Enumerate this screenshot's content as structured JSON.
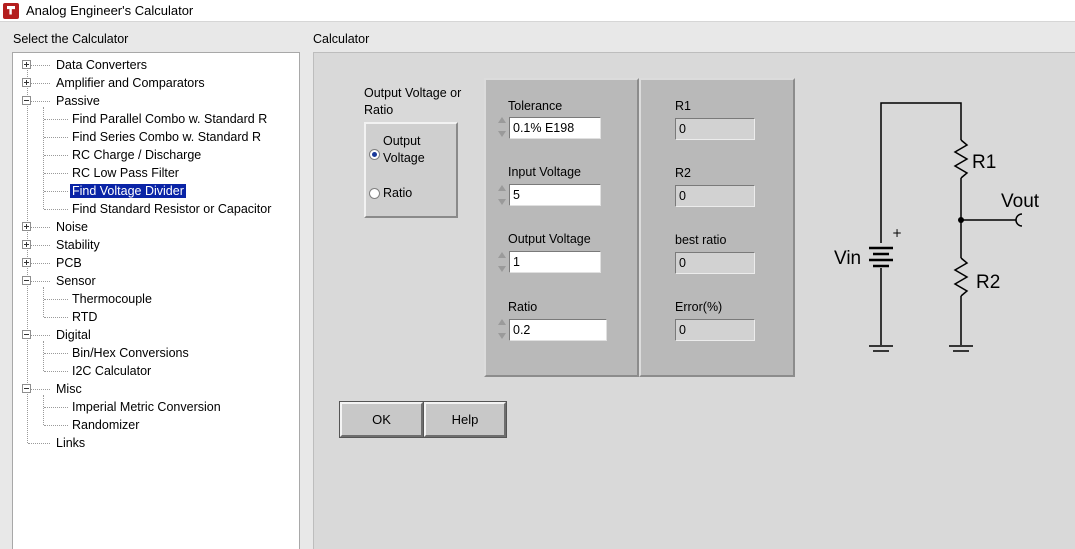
{
  "window": {
    "title": "Analog Engineer's Calculator"
  },
  "left_panel": {
    "label": "Select the Calculator",
    "tree": [
      {
        "label": "Data Converters",
        "level": 0,
        "expander": "plus"
      },
      {
        "label": "Amplifier and Comparators",
        "level": 0,
        "expander": "plus"
      },
      {
        "label": "Passive",
        "level": 0,
        "expander": "minus"
      },
      {
        "label": "Find Parallel Combo w. Standard R",
        "level": 1
      },
      {
        "label": "Find Series Combo w. Standard R",
        "level": 1
      },
      {
        "label": "RC Charge / Discharge",
        "level": 1
      },
      {
        "label": "RC Low Pass Filter",
        "level": 1
      },
      {
        "label": "Find Voltage Divider",
        "level": 1,
        "selected": true
      },
      {
        "label": "Find Standard Resistor or Capacitor",
        "level": 1
      },
      {
        "label": "Noise",
        "level": 0,
        "expander": "plus"
      },
      {
        "label": "Stability",
        "level": 0,
        "expander": "plus"
      },
      {
        "label": "PCB",
        "level": 0,
        "expander": "plus"
      },
      {
        "label": "Sensor",
        "level": 0,
        "expander": "minus"
      },
      {
        "label": "Thermocouple",
        "level": 1
      },
      {
        "label": "RTD",
        "level": 1
      },
      {
        "label": "Digital",
        "level": 0,
        "expander": "minus"
      },
      {
        "label": "Bin/Hex Conversions",
        "level": 1
      },
      {
        "label": "I2C Calculator",
        "level": 1
      },
      {
        "label": "Misc",
        "level": 0,
        "expander": "minus"
      },
      {
        "label": "Imperial Metric Conversion",
        "level": 1
      },
      {
        "label": "Randomizer",
        "level": 1
      },
      {
        "label": "Links",
        "level": 0
      }
    ]
  },
  "calculator": {
    "label": "Calculator",
    "mode": {
      "label": "Output Voltage or Ratio",
      "options": [
        {
          "label": "Output Voltage",
          "selected": true
        },
        {
          "label": "Ratio",
          "selected": false
        }
      ]
    },
    "inputs": {
      "tolerance": {
        "label": "Tolerance",
        "value": "0.1% E198"
      },
      "input_voltage": {
        "label": "Input Voltage",
        "value": "5"
      },
      "output_voltage": {
        "label": "Output Voltage",
        "value": "1"
      },
      "ratio": {
        "label": "Ratio",
        "value": "0.2"
      }
    },
    "outputs": {
      "r1": {
        "label": "R1",
        "value": "0"
      },
      "r2": {
        "label": "R2",
        "value": "0"
      },
      "best_ratio": {
        "label": "best ratio",
        "value": "0"
      },
      "error": {
        "label": "Error(%)",
        "value": "0"
      }
    },
    "buttons": {
      "ok": "OK",
      "help": "Help"
    },
    "schematic": {
      "vin": "Vin",
      "plus": "+",
      "r1": "R1",
      "r2": "R2",
      "vout": "Vout"
    }
  },
  "colors": {
    "selection": "#0a24a6",
    "panel": "#d9d9d9",
    "group": "#b9b9b9"
  }
}
